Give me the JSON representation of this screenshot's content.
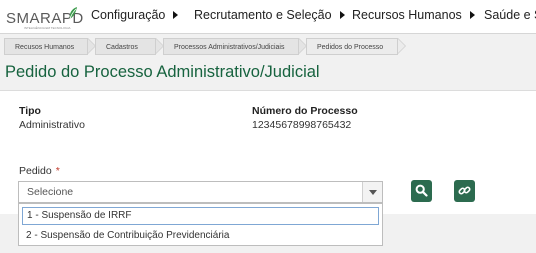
{
  "logo": {
    "text": "SMARAPD",
    "subtext": "INTELIGÊNCIA EM TECNOLOGIA"
  },
  "nav": {
    "items": [
      {
        "label": "Configuração"
      },
      {
        "label": "Recrutamento e Seleção"
      },
      {
        "label": "Recursos Humanos"
      },
      {
        "label": "Saúde e Se"
      }
    ]
  },
  "breadcrumb": [
    {
      "label": "Recusos Humanos"
    },
    {
      "label": "Cadastros"
    },
    {
      "label": "Processos Administrativos/Judiciais"
    },
    {
      "label": "Pedidos do Processo"
    }
  ],
  "page": {
    "title": "Pedido do Processo Administrativo/Judicial"
  },
  "form": {
    "tipo_label": "Tipo",
    "tipo_value": "Administrativo",
    "numero_label": "Número do Processo",
    "numero_value": "12345678998765432",
    "pedido_label": "Pedido",
    "pedido_required": "*",
    "pedido_selected": "Selecione"
  },
  "dropdown": {
    "options": [
      {
        "label": "1 - Suspensão de IRRF"
      },
      {
        "label": "2 - Suspensão de Contribuição Previdenciária"
      }
    ]
  },
  "icons": {
    "search": "search-icon",
    "link": "link-icon"
  },
  "colors": {
    "accent": "#2c6b4f",
    "title": "#17633f"
  }
}
